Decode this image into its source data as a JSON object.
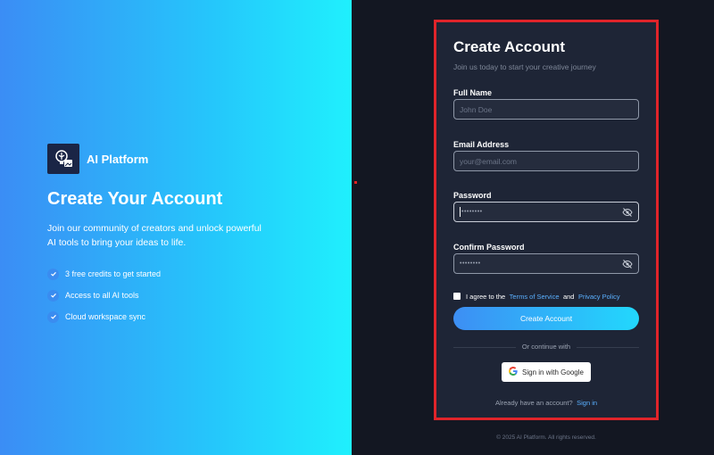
{
  "left": {
    "brand_name": "AI Platform",
    "title": "Create Your Account",
    "description": "Join our community of creators and unlock powerful AI tools to bring your ideas to life.",
    "features": [
      {
        "text": "3 free credits to get started",
        "icon": "check-icon"
      },
      {
        "text": "Access to all AI tools",
        "icon": "check-icon"
      },
      {
        "text": "Cloud workspace sync",
        "icon": "check-icon"
      }
    ]
  },
  "form": {
    "title": "Create Account",
    "subtitle": "Join us today to start your creative journey",
    "full_name": {
      "label": "Full Name",
      "placeholder": "John Doe",
      "value": ""
    },
    "email": {
      "label": "Email Address",
      "placeholder": "your@email.com",
      "value": ""
    },
    "password": {
      "label": "Password",
      "masked": "••••••••"
    },
    "confirm_password": {
      "label": "Confirm Password",
      "masked": "••••••••"
    },
    "agree": {
      "prefix": "I agree to the",
      "terms": "Terms of Service",
      "and": "and",
      "privacy": "Privacy Policy",
      "checked": false
    },
    "submit_label": "Create Account",
    "divider_text": "Or continue with",
    "google_label": "Sign in with Google",
    "signin_prompt": "Already have an account?",
    "signin_link": "Sign in"
  },
  "footer": "© 2025 AI Platform. All rights reserved.",
  "colors": {
    "accent": "#3b8df5",
    "accent_end": "#22d8fd",
    "highlight_border": "#e0242a",
    "link": "#5ab0ff",
    "card_bg": "#1e2536",
    "page_bg": "#131722"
  }
}
